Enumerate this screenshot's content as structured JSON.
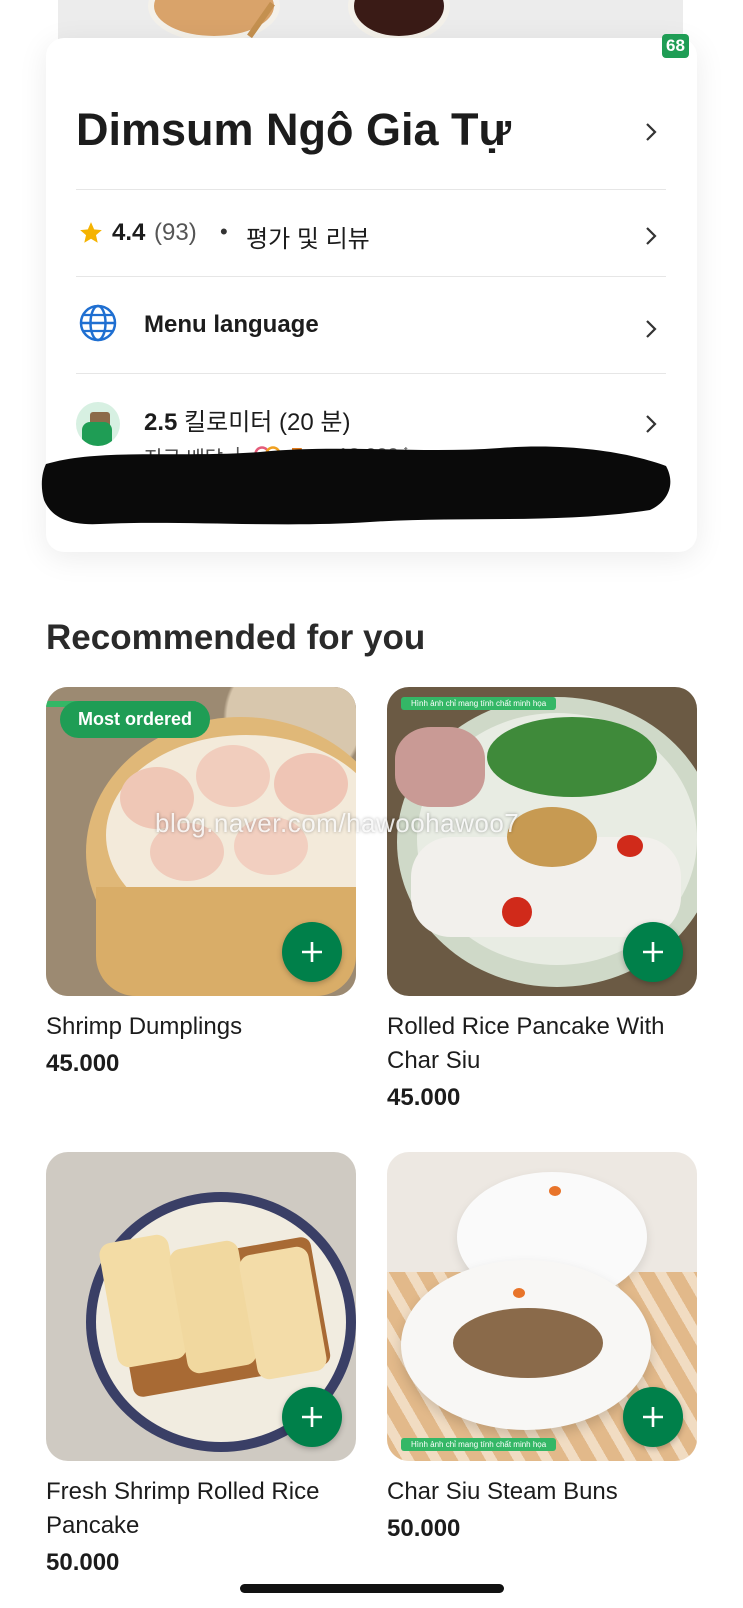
{
  "header": {
    "badge": "68"
  },
  "restaurant": {
    "name": "Dimsum Ngô Gia Tự",
    "rating": "4.4",
    "rating_count": "(93)",
    "rating_dot": "•",
    "reviews_label": "평가 및 리뷰",
    "menu_language_label": "Menu language",
    "distance_value": "2.5",
    "distance_rest": " 킬로미터 (20 분)",
    "delivery_type": "지금 배달",
    "separator": "|",
    "free_label": "Free",
    "old_fee": "13.000₫"
  },
  "section": {
    "title": "Recommended for you"
  },
  "watermark": "blog.naver.com/hawoohawoo7",
  "items": [
    {
      "name": "Shrimp Dumplings",
      "price": "45.000",
      "tag": "Most ordered"
    },
    {
      "name": "Rolled Rice Pancake With Char Siu",
      "price": "45.000",
      "mini_label": "Hình ảnh chỉ mang tính chất minh họa"
    },
    {
      "name": "Fresh Shrimp Rolled Rice Pancake",
      "price": "50.000"
    },
    {
      "name": "Char Siu Steam Buns",
      "price": "50.000",
      "mini_label": "Hình ảnh chỉ mang tính chất minh họa"
    }
  ],
  "colors": {
    "brand_green": "#00804a",
    "free_orange": "#e07a1c",
    "star_yellow": "#f5b301"
  }
}
